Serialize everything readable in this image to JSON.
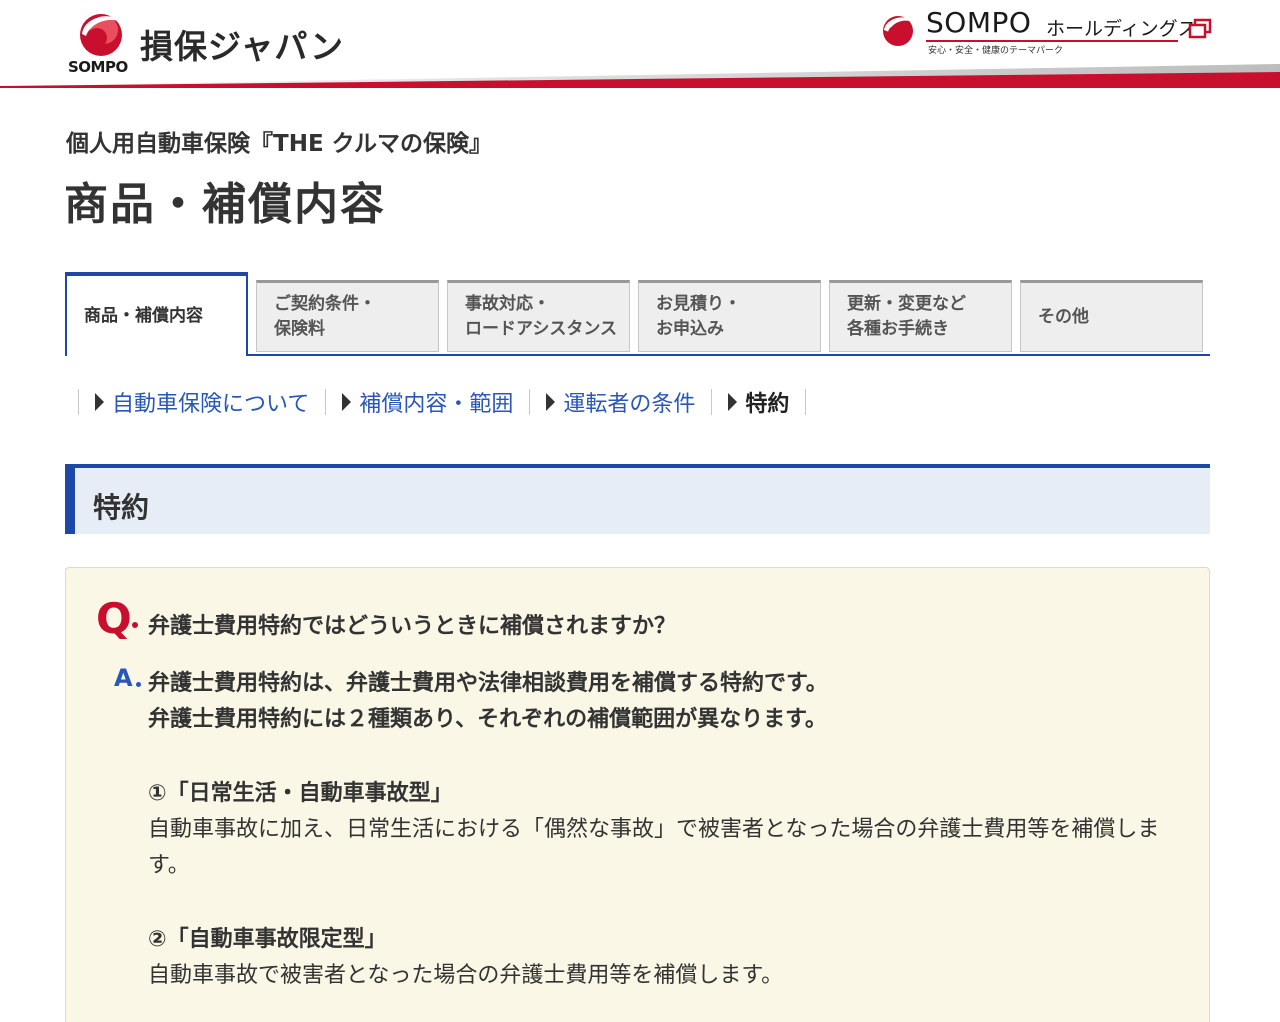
{
  "header": {
    "brand_logo_text": "SOMPO",
    "brand_name": "損保ジャパン",
    "holdings_sompo": "SOMPO",
    "holdings_suffix": "ホールディングス",
    "holdings_tagline": "安心・安全・健康のテーマパーク",
    "colors": {
      "brand_red": "#c8102e",
      "brand_blue": "#1e48a8"
    }
  },
  "page": {
    "subtitle": "個人用自動車保険『THE クルマの保険』",
    "title": "商品・補償内容"
  },
  "tabs": [
    {
      "label": "商品・補償内容",
      "active": true
    },
    {
      "label": "ご契約条件・\n保険料",
      "active": false
    },
    {
      "label": "事故対応・\nロードアシスタンス",
      "active": false
    },
    {
      "label": "お見積り・\nお申込み",
      "active": false
    },
    {
      "label": "更新・変更など\n各種お手続き",
      "active": false
    },
    {
      "label": "その他",
      "active": false
    }
  ],
  "subnav": [
    {
      "label": "自動車保険について",
      "current": false
    },
    {
      "label": "補償内容・範囲",
      "current": false
    },
    {
      "label": "運転者の条件",
      "current": false
    },
    {
      "label": "特約",
      "current": true
    }
  ],
  "section": {
    "title": "特約"
  },
  "qa": {
    "q_mark": "Q",
    "question": "弁護士費用特約ではどういうときに補償されますか？",
    "a_mark": "A",
    "answer_line1": "弁護士費用特約は、弁護士費用や法律相談費用を補償する特約です。",
    "answer_line2": "弁護士費用特約には２種類あり、それぞれの補償範囲が異なります。",
    "type1_title": "①「日常生活・自動車事故型」",
    "type1_desc": "自動車事故に加え、日常生活における「偶然な事故」で被害者となった場合の弁護士費用等を補償します。",
    "type2_title": "②「自動車事故限定型」",
    "type2_desc": "自動車事故で被害者となった場合の弁護士費用等を補償します。"
  }
}
